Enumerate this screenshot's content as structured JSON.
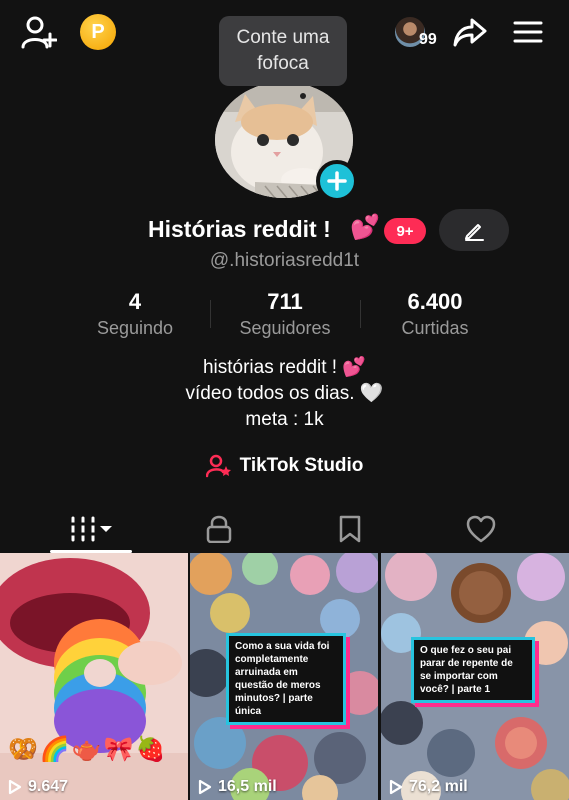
{
  "tooltip": {
    "text": "Conte uma\nfofoca"
  },
  "header": {
    "viewer_count": "99",
    "coin_letter": "P"
  },
  "profile": {
    "display_name": "Histórias reddit !",
    "name_emoji": "💕",
    "notification_badge": "9+",
    "handle": "@.historiasredd1t"
  },
  "stats": [
    {
      "value": "4",
      "label": "Seguindo"
    },
    {
      "value": "711",
      "label": "Seguidores"
    },
    {
      "value": "6.400",
      "label": "Curtidas"
    }
  ],
  "bio": {
    "line1": "histórias reddit ! 💕",
    "line2": "vídeo todos os dias. 🤍",
    "line3": "meta : 1k"
  },
  "studio": {
    "label": "TikTok Studio"
  },
  "tabs": [
    {
      "icon": "grid-icon",
      "active": true
    },
    {
      "icon": "lock-icon",
      "active": false
    },
    {
      "icon": "bookmark-icon",
      "active": false
    },
    {
      "icon": "heart-icon",
      "active": false
    }
  ],
  "videos": [
    {
      "views": "9.647",
      "caption": "",
      "emojis": "🥨🌈🫖🎀🍓"
    },
    {
      "views": "16,5 mil",
      "caption": "Como a sua vida foi completamente arruinada em questão de meros minutos? | parte única"
    },
    {
      "views": "76,2 mil",
      "caption": "O que fez o seu pai parar de repente de se importar com você? | parte 1"
    }
  ],
  "colors": {
    "accent_pink": "#fe2c55",
    "accent_cyan": "#1ec1d8",
    "background": "#121212"
  }
}
